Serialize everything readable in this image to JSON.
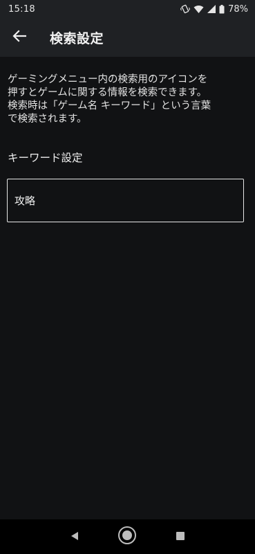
{
  "status_bar": {
    "time": "15:18",
    "battery": "78%",
    "icons": [
      "vibrate-icon",
      "wifi-icon",
      "signal-icon",
      "battery-icon"
    ]
  },
  "app_bar": {
    "back_icon": "arrow-left-icon",
    "title": "検索設定"
  },
  "main": {
    "description": "ゲーミングメニュー内の検索用のアイコンを\n押すとゲームに関する情報を検索できます。\n検索時は「ゲーム名 キーワード」という言葉\nで検索されます。",
    "keyword_section_label": "キーワード設定",
    "keyword_value": "攻略"
  },
  "nav_bar": {
    "icons": [
      "back-triangle-icon",
      "home-circle-icon",
      "recents-square-icon"
    ]
  },
  "colors": {
    "background": "#111214",
    "bar": "#1f2124",
    "text": "#e8e8e8",
    "nav": "#000000"
  }
}
